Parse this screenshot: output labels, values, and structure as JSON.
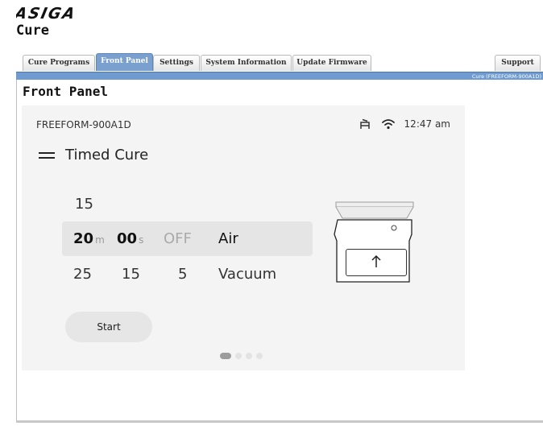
{
  "app": {
    "brand": "ASIGA",
    "title": "Cure"
  },
  "tabs": [
    {
      "label": "Cure Programs",
      "active": false
    },
    {
      "label": "Front Panel",
      "active": true
    },
    {
      "label": "Settings",
      "active": false
    },
    {
      "label": "System Information",
      "active": false
    },
    {
      "label": "Update Firmware",
      "active": false
    },
    {
      "label": "Support",
      "active": false
    }
  ],
  "status_bar": {
    "text": "Cure (FREEFORM-900A1D)"
  },
  "panel": {
    "title": "Front Panel"
  },
  "device": {
    "name": "FREEFORM-900A1D",
    "time": "12:47 am",
    "icons": [
      "lamp-icon",
      "wifi-icon",
      "menu-icon"
    ],
    "mode_title": "Timed Cure",
    "picker": {
      "row_above": {
        "minutes": "15"
      },
      "row_selected": {
        "minutes": "20",
        "minutes_unit": "m",
        "seconds": "00",
        "seconds_unit": "s",
        "setting": "OFF",
        "atmosphere": "Air"
      },
      "row_below": {
        "minutes": "25",
        "seconds": "15",
        "setting": "5",
        "atmosphere": "Vacuum"
      }
    },
    "start_label": "Start",
    "lift_button_icon": "arrow-up-icon",
    "page_indicator": {
      "pages": 4,
      "current": 1
    }
  },
  "colors": {
    "tab_active": "#7aa0cf",
    "status_bar": "#6f9bd1",
    "device_bg": "#f4f4f4",
    "highlight": "#e5e5e5"
  }
}
